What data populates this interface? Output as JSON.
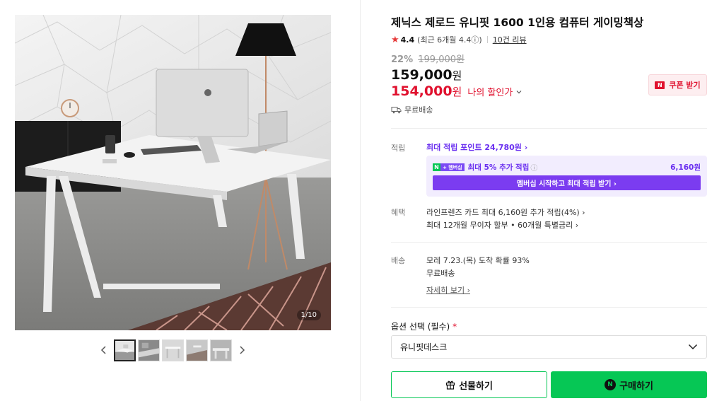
{
  "gallery": {
    "counter": "1/10",
    "thumbnails": [
      "thumb-1",
      "thumb-2",
      "thumb-3",
      "thumb-4",
      "thumb-5"
    ],
    "prev_icon": "chevron-left-icon",
    "next_icon": "chevron-right-icon"
  },
  "product": {
    "title": "제닉스 제로드 유니핏 1600 1인용 컴퓨터 게이밍책상",
    "rating": {
      "score": "4.4",
      "recent": "(최근 6개월 4.4ⓘ)",
      "reviews": "10건 리뷰"
    },
    "discount_pct": "22%",
    "original_price": "199,000원",
    "price": "159,000",
    "price_unit": "원",
    "my_price": "154,000",
    "my_price_unit": "원",
    "my_price_label": "나의 할인가",
    "coupon_button": "쿠폰 받기",
    "coupon_badge": "N",
    "shipping_tag": "무료배송"
  },
  "points": {
    "label": "적립",
    "max_points_link": "최대 적립 포인트 24,780원 ›",
    "membership": {
      "badge_n": "N",
      "badge_plus": "+ 멤버십",
      "text": "최대 5% 추가 적립",
      "amount": "6,160원",
      "button": "멤버십 시작하고 최대 적립 받기 ›"
    }
  },
  "benefits": {
    "label": "혜택",
    "lines": [
      "라인프렌즈 카드 최대 6,160원 추가 적립(4%) ›",
      "최대 12개월 무이자 할부 • 60개월 특별금리 ›"
    ]
  },
  "delivery": {
    "label": "배송",
    "arrival": "모레 7.23.(목) 도착 확률 93%",
    "fee": "무료배송",
    "detail_link": "자세히 보기 ›"
  },
  "options": {
    "label": "옵션 선택 (필수)",
    "required_mark": "*",
    "selected": "유니핏데스크"
  },
  "actions": {
    "gift": "선물하기",
    "buy": "구매하기",
    "buy_badge": "N"
  },
  "colors": {
    "accent_red": "#e0112e",
    "naver_green": "#06c755",
    "membership_purple": "#7b3cf0"
  }
}
